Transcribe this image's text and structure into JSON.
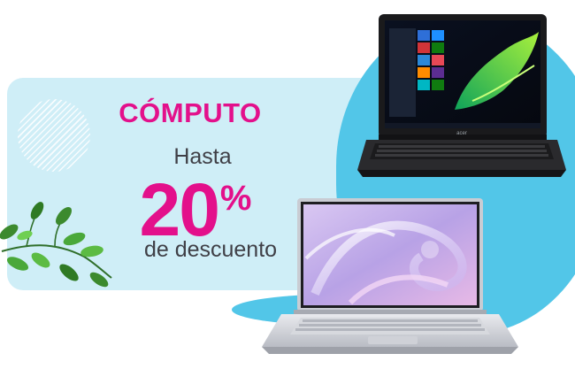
{
  "promo": {
    "category": "CÓMPUTO",
    "prefix": "Hasta",
    "percent_value": "20",
    "percent_symbol": "%",
    "suffix": "de descuento"
  },
  "colors": {
    "accent": "#e3108b",
    "text": "#3f3f46",
    "panel": "#cfeef7",
    "blob": "#52c6e8"
  },
  "images": {
    "laptop_1": "black-laptop",
    "laptop_2": "silver-laptop",
    "decor": "green-leaves"
  },
  "laptop_black": {
    "brand": "acer"
  }
}
